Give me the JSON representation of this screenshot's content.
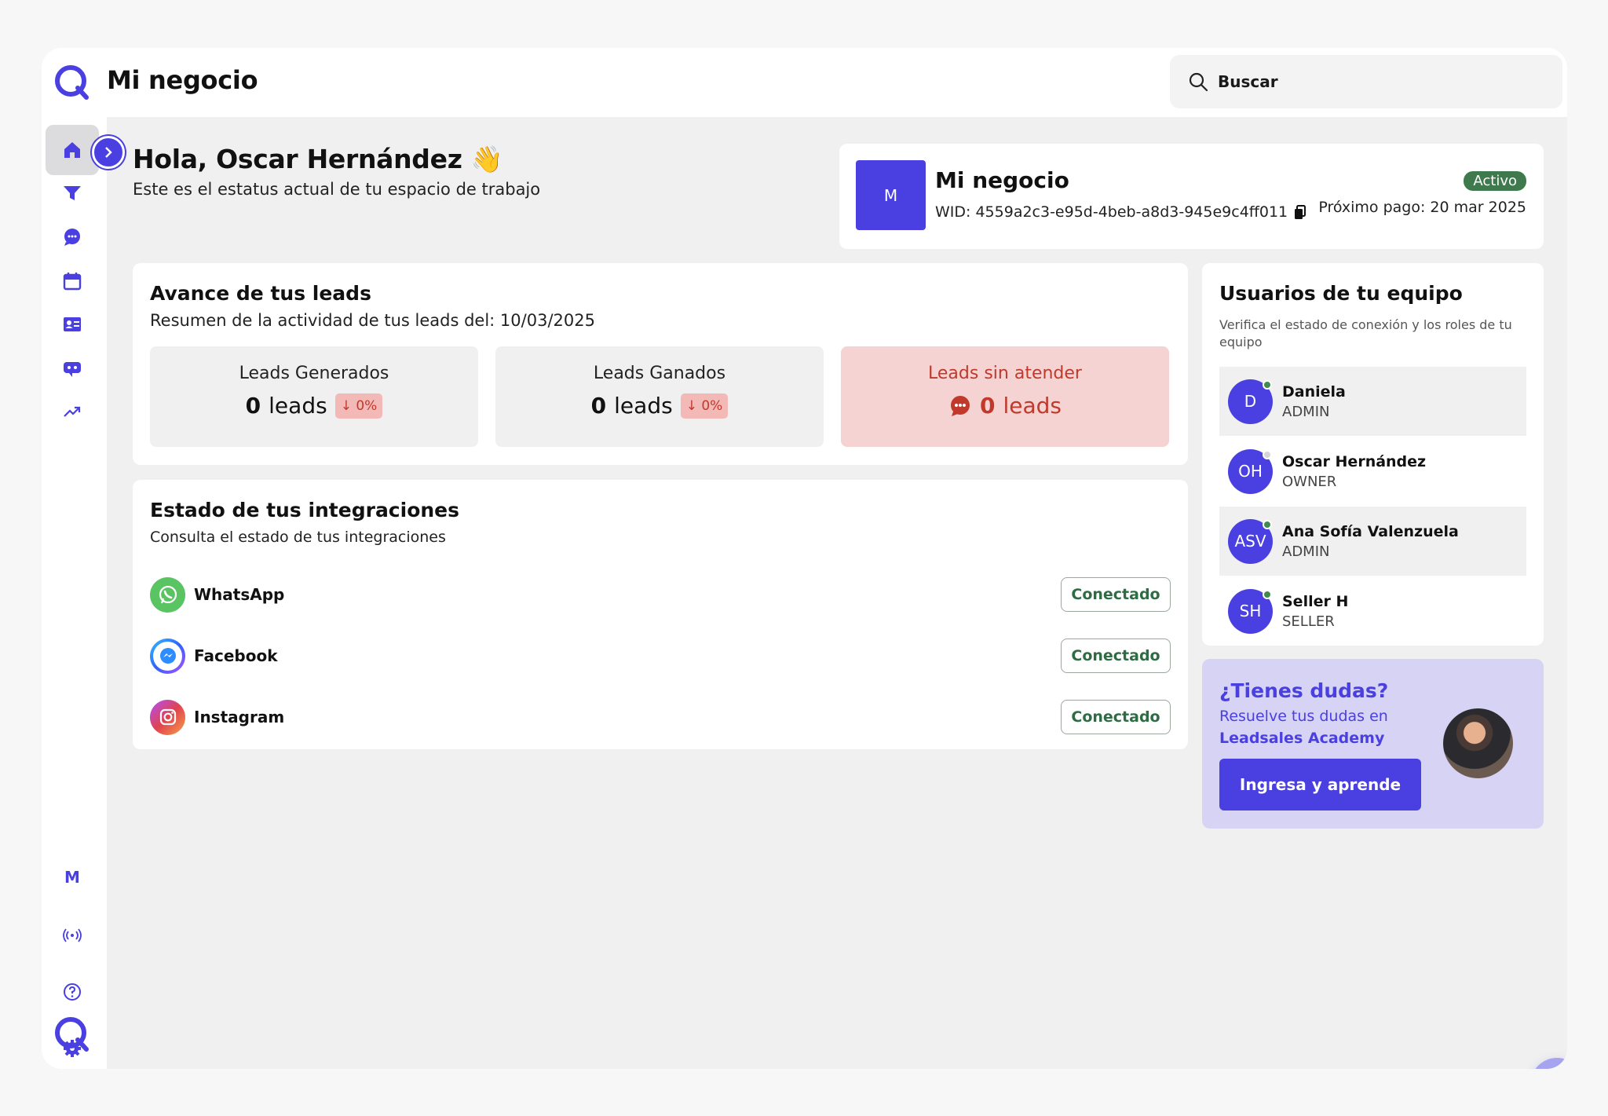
{
  "header": {
    "title": "Mi negocio",
    "search_placeholder": "Buscar"
  },
  "sidebar": {
    "items": [
      "home-icon",
      "funnel-icon",
      "chat-icon",
      "calendar-icon",
      "contact-card-icon",
      "bot-icon",
      "trending-up-icon"
    ],
    "bottom": {
      "workspace_initial": "M",
      "items": [
        "broadcast-icon",
        "help-icon",
        "settings-icon"
      ]
    }
  },
  "greeting": {
    "title": "Hola, Oscar Hernández 👋",
    "subtitle": "Este es el estatus actual de tu espacio de trabajo"
  },
  "business": {
    "initial": "M",
    "name": "Mi negocio",
    "wid": "WID: 4559a2c3-e95d-4beb-a8d3-945e9c4ff011",
    "status": "Activo",
    "next_payment": "Próximo pago: 20 mar 2025"
  },
  "leads": {
    "title": "Avance de tus leads",
    "subtitle": "Resumen de la actividad de tus leads del: 10/03/2025",
    "kpis": [
      {
        "label": "Leads Generados",
        "value": "0",
        "unit": "leads",
        "change": "↓ 0%"
      },
      {
        "label": "Leads Ganados",
        "value": "0",
        "unit": "leads",
        "change": "↓ 0%"
      },
      {
        "label": "Leads sin atender",
        "value": "0",
        "unit": "leads"
      }
    ]
  },
  "integrations": {
    "title": "Estado de tus integraciones",
    "subtitle": "Consulta el estado de tus integraciones",
    "items": [
      {
        "name": "WhatsApp",
        "status": "Conectado",
        "color": "#5ac462"
      },
      {
        "name": "Facebook",
        "status": "Conectado",
        "color": "#2d8cff"
      },
      {
        "name": "Instagram",
        "status": "Conectado",
        "color": "#dd4f5f"
      }
    ]
  },
  "team": {
    "title": "Usuarios de tu equipo",
    "subtitle": "Verifica el estado de conexión y los roles de tu equipo",
    "members": [
      {
        "initials": "D",
        "name": "Daniela",
        "role": "ADMIN",
        "online": true
      },
      {
        "initials": "OH",
        "name": "Oscar Hernández",
        "role": "OWNER",
        "online": false
      },
      {
        "initials": "ASV",
        "name": "Ana Sofía Valenzuela",
        "role": "ADMIN",
        "online": true
      },
      {
        "initials": "SH",
        "name": "Seller H",
        "role": "SELLER",
        "online": true
      }
    ]
  },
  "help": {
    "title": "¿Tienes dudas?",
    "line1": "Resuelve tus dudas en",
    "line2": "Leadsales Academy",
    "button": "Ingresa y aprende"
  },
  "colors": {
    "accent": "#4a3fe0",
    "success": "#3f7a4e",
    "danger": "#c0392b"
  }
}
